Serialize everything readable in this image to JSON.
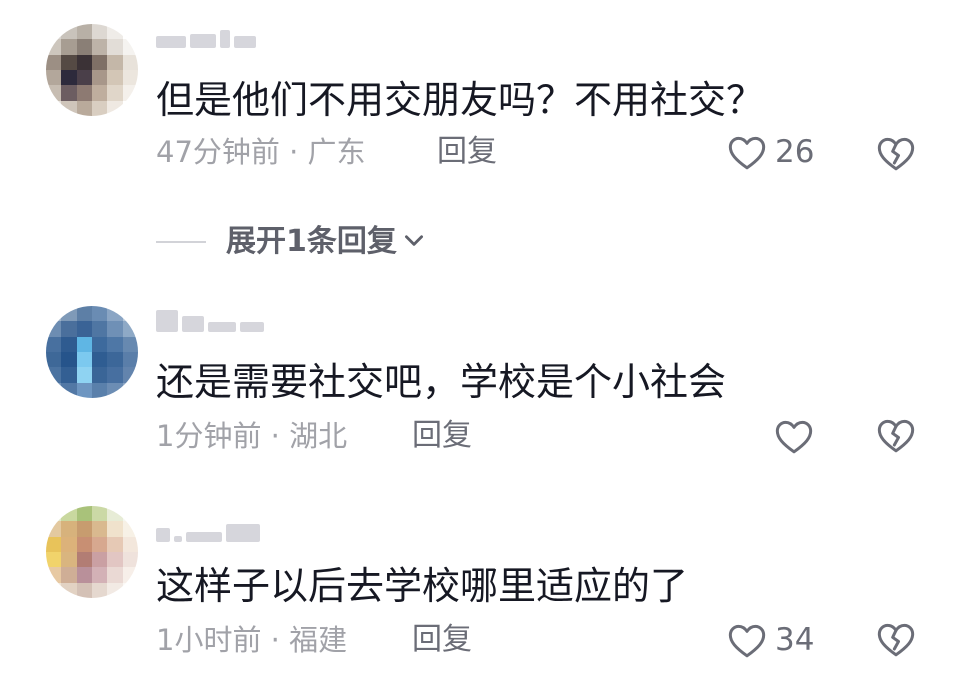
{
  "comments": [
    {
      "text": "但是他们不用交朋友吗？不用社交？",
      "time_location": "47分钟前 · 广东",
      "reply_label": "回复",
      "like_count": "26",
      "avatar_colors": [
        "#d8d4ce",
        "#c9c3bb",
        "#b8b0a6",
        "#ddd8d2",
        "#efece8",
        "#ffffff",
        "#cdc6bd",
        "#a79d92",
        "#8a7f76",
        "#bdb3a8",
        "#e2ddd7",
        "#f5f3f0",
        "#9c8f84",
        "#554a44",
        "#3b3236",
        "#7f7066",
        "#c4b7a8",
        "#e8e2da",
        "#b3a79b",
        "#2d2a3c",
        "#4a3f49",
        "#a8978a",
        "#d3c6b6",
        "#ece6de",
        "#c7bdb2",
        "#6c5d61",
        "#8d7a72",
        "#bfae9e",
        "#e0d6c9",
        "#f4f0eb",
        "#e6e1db",
        "#cfc5ba",
        "#b9aa9b",
        "#d9cec1",
        "#efe9e2",
        "#ffffff"
      ]
    },
    {
      "text": "还是需要社交吧，学校是个小社会",
      "time_location": "1分钟前 · 湖北",
      "reply_label": "回复",
      "like_count": "",
      "avatar_colors": [
        "#9fb3c9",
        "#7f9ab8",
        "#5d7fa6",
        "#6a8cb3",
        "#8aa5c4",
        "#b5c6d8",
        "#6d8db2",
        "#4a6f9c",
        "#3a6396",
        "#4f76a3",
        "#6f90b6",
        "#8ea9c6",
        "#48709f",
        "#2f5b90",
        "#5fb6e4",
        "#3d6a9d",
        "#4e77a6",
        "#6789b0",
        "#3e6898",
        "#26548b",
        "#7cc9ef",
        "#2f5d92",
        "#3c6799",
        "#5a7ea9",
        "#4b73a1",
        "#335f93",
        "#8fd3f2",
        "#3a6597",
        "#476fa0",
        "#6384ad",
        "#7091b7",
        "#5278a5",
        "#6e96c1",
        "#5a80ab",
        "#6c8db4",
        "#8aa4c3"
      ]
    },
    {
      "text": "这样子以后去学校哪里适应的了",
      "time_location": "1小时前 · 福建",
      "reply_label": "回复",
      "like_count": "34",
      "avatar_colors": [
        "#dfe7c9",
        "#c9d89f",
        "#a9c27a",
        "#cbd9a6",
        "#e7ecd6",
        "#f4f6ee",
        "#e3c9a0",
        "#d7b27c",
        "#c79c6f",
        "#d9b98f",
        "#f0e2cc",
        "#f7f1e6",
        "#e8c35a",
        "#dcb27a",
        "#c88f73",
        "#d7a88f",
        "#e6c9b5",
        "#f3e7dc",
        "#f1d36b",
        "#d9b57f",
        "#b27d74",
        "#caa0a3",
        "#e2c6c3",
        "#efe2dc",
        "#e7c9a3",
        "#cfae96",
        "#b9909a",
        "#d3b1b6",
        "#ead9d4",
        "#f7efe9",
        "#efe3d3",
        "#e2d2c3",
        "#d4c1b6",
        "#e5d8cf",
        "#f2eae4",
        "#fbf8f5"
      ]
    }
  ],
  "expand_replies": {
    "label": "展开1条回复"
  },
  "icons": {
    "like": "heart-outline-icon",
    "dislike": "broken-heart-icon",
    "expand": "chevron-down-icon"
  },
  "colors": {
    "text_primary": "#161823",
    "text_secondary": "#a1a2a8",
    "reply_text": "#6b6d77",
    "icon_stroke": "#6b6d77"
  }
}
